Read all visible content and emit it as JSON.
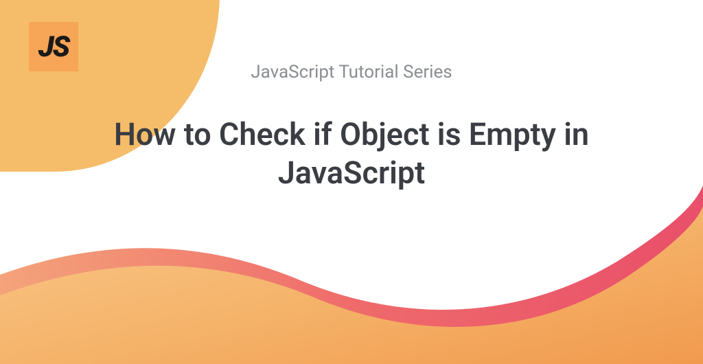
{
  "badge": {
    "text": "JS"
  },
  "header": {
    "subtitle": "JavaScript Tutorial Series",
    "title": "How to Check if Object is Empty in JavaScript"
  },
  "colors": {
    "blob_yellow": "#f5bd6a",
    "badge_orange": "#f7a556",
    "wave_coral": "#f15b5b",
    "wave_orange_light": "#f9c27a",
    "wave_orange_dark": "#f29b4f",
    "subtitle_gray": "#8a8d91",
    "title_dark": "#3a3d42"
  }
}
